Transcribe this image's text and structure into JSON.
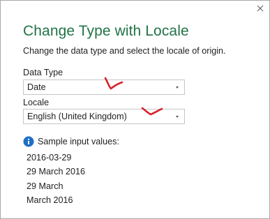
{
  "dialog": {
    "title": "Change Type with Locale",
    "description": "Change the data type and select the locale of origin.",
    "accent_color": "#217346"
  },
  "data_type": {
    "label": "Data Type",
    "selected": "Date"
  },
  "locale": {
    "label": "Locale",
    "selected": "English (United Kingdom)"
  },
  "sample": {
    "label": "Sample input values:",
    "values": [
      "2016-03-29",
      "29 March 2016",
      "29 March",
      "March 2016"
    ]
  },
  "annotations": {
    "mark_color": "#d9202a"
  }
}
